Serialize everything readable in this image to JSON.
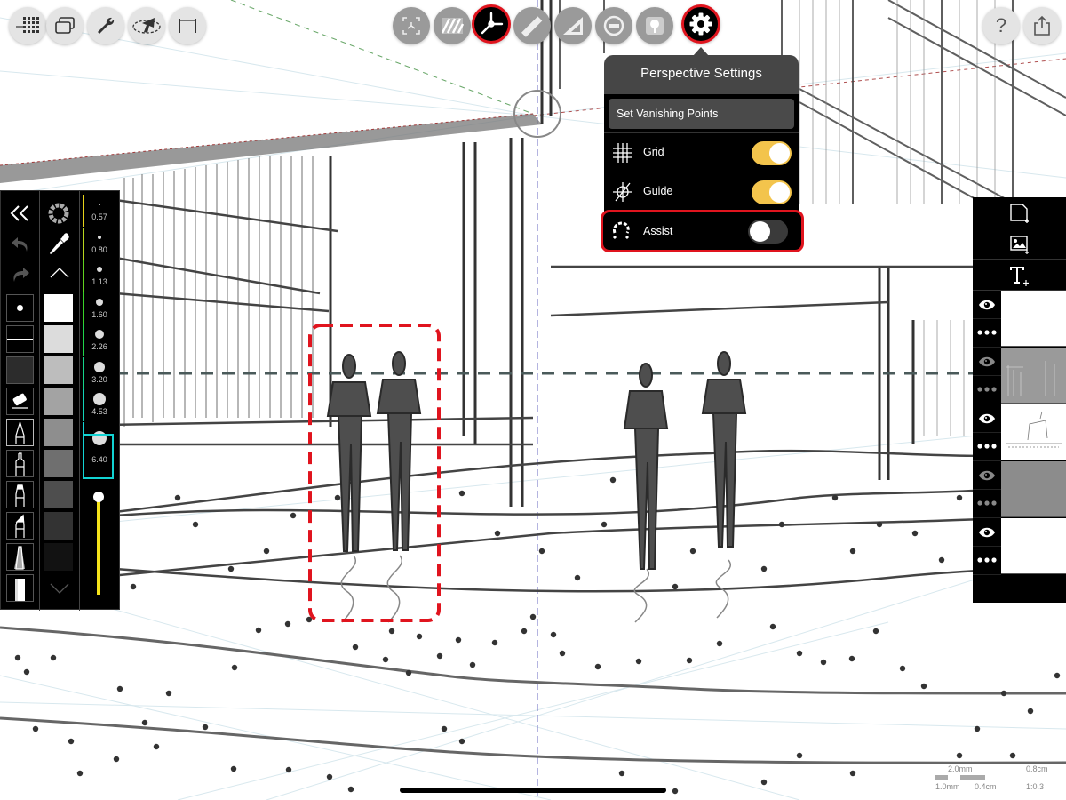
{
  "app": {
    "top_left_tools": [
      {
        "name": "grid-menu-icon"
      },
      {
        "name": "layers-canvas-icon"
      },
      {
        "name": "wrench-icon"
      },
      {
        "name": "transform-orbit-icon"
      },
      {
        "name": "measure-span-icon"
      }
    ],
    "top_center_tools": [
      {
        "name": "symmetry-icon",
        "active": false
      },
      {
        "name": "hatch-icon",
        "active": false
      },
      {
        "name": "perspective-icon",
        "active": true
      },
      {
        "name": "ruler-icon",
        "active": false
      },
      {
        "name": "set-square-icon",
        "active": false
      },
      {
        "name": "ellipse-guide-icon",
        "active": false
      },
      {
        "name": "stamp-tree-icon",
        "active": false
      },
      {
        "name": "gear-icon",
        "active": true
      }
    ],
    "top_right_tools": [
      {
        "name": "help-icon",
        "glyph": "?"
      },
      {
        "name": "share-icon"
      }
    ]
  },
  "perspective_settings": {
    "title": "Perspective Settings",
    "set_vanishing_points": "Set Vanishing Points",
    "rows": [
      {
        "label": "Grid",
        "icon": "grid-icon",
        "on": true
      },
      {
        "label": "Guide",
        "icon": "guide-icon",
        "on": true
      },
      {
        "label": "Assist",
        "icon": "magnet-icon",
        "on": false
      }
    ]
  },
  "left_panel": {
    "nav": [
      "collapse-icon",
      "undo-icon",
      "redo-icon"
    ],
    "brush_shapes": [
      "dot-brush-icon",
      "line-brush-icon",
      "fill-brush-icon",
      "eraser-icon",
      "pen-icon",
      "fineliner-icon",
      "marker-icon",
      "chisel-marker-icon",
      "pencil-icon",
      "airbrush-icon"
    ],
    "gray_swatches": [
      "#ffffff",
      "#dcdcdc",
      "#bdbdbd",
      "#a3a3a3",
      "#8e8e8e",
      "#6f6f6f",
      "#4e4e4e",
      "#333333",
      "#121212"
    ],
    "brush_sizes": [
      {
        "value": "0.57",
        "color": "#e6d21a"
      },
      {
        "value": "0.80",
        "color": "#b9d51e"
      },
      {
        "value": "1.13",
        "color": "#62d21e"
      },
      {
        "value": "1.60",
        "color": "#3ad328"
      },
      {
        "value": "2.26",
        "color": "#20d44a"
      },
      {
        "value": "3.20",
        "color": "#15d48a"
      },
      {
        "value": "4.53",
        "color": "#12d4b8"
      },
      {
        "value": "6.40",
        "color": "#12d4d4"
      }
    ],
    "selected_size": "6.40",
    "opacity_slider": {
      "value": 1.0,
      "color": "#f5e31a"
    }
  },
  "right_panel": {
    "actions": [
      "new-layer-icon",
      "add-image-icon",
      "add-text-icon"
    ],
    "layers": [
      {
        "visible": true,
        "thumb": "#ffffff"
      },
      {
        "visible": true,
        "thumb": "#9a9a9a",
        "dim": true
      },
      {
        "visible": true,
        "thumb": "#ffffff",
        "sketch": true
      },
      {
        "visible": true,
        "thumb": "#8c8c8c",
        "dim": true
      },
      {
        "visible": true,
        "thumb": "#ffffff"
      }
    ]
  },
  "scale_indicator": {
    "top_left": "2.0mm",
    "top_right": "0.8cm",
    "bottom": [
      "1.0mm",
      "0.4cm",
      "1:0.3"
    ]
  }
}
